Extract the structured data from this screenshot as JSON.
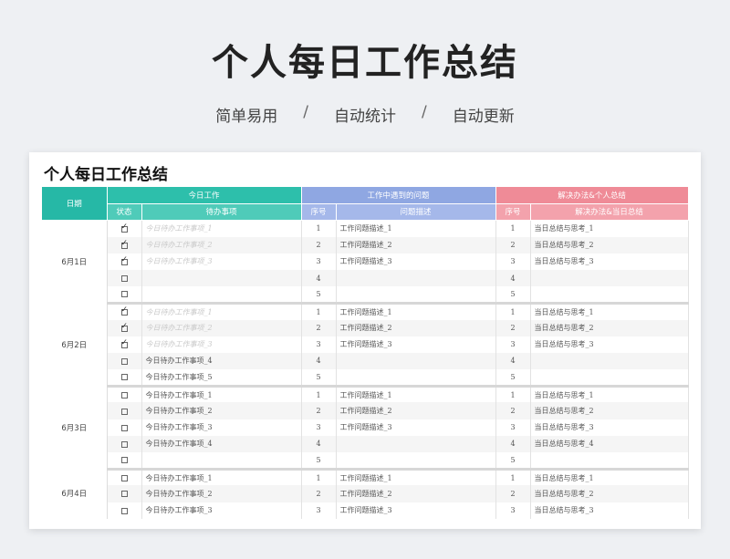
{
  "header": {
    "title": "个人每日工作总结",
    "subtitle_items": [
      "简单易用",
      "自动统计",
      "自动更新"
    ],
    "separator": "/"
  },
  "sheet": {
    "title": "个人每日工作总结",
    "columns": {
      "date": "日期",
      "group_today": "今日工作",
      "group_problems": "工作中遇到的问题",
      "group_solutions": "解决办法&个人总结",
      "status": "状态",
      "todo": "待办事项",
      "seq1": "序号",
      "problem_desc": "问题描述",
      "seq2": "序号",
      "solution_desc": "解决办法&当日总结"
    },
    "days": [
      {
        "date": "6月1日",
        "rows": [
          {
            "checked": true,
            "todo": "今日待办工作事项_1",
            "done": true,
            "seq": "1",
            "problem": "工作问题描述_1",
            "seq2": "1",
            "summary": "当日总结与思考_1"
          },
          {
            "checked": true,
            "todo": "今日待办工作事项_2",
            "done": true,
            "seq": "2",
            "problem": "工作问题描述_2",
            "seq2": "2",
            "summary": "当日总结与思考_2"
          },
          {
            "checked": true,
            "todo": "今日待办工作事项_3",
            "done": true,
            "seq": "3",
            "problem": "工作问题描述_3",
            "seq2": "3",
            "summary": "当日总结与思考_3"
          },
          {
            "checked": false,
            "todo": "",
            "done": false,
            "seq": "4",
            "problem": "",
            "seq2": "4",
            "summary": ""
          },
          {
            "checked": false,
            "todo": "",
            "done": false,
            "seq": "5",
            "problem": "",
            "seq2": "5",
            "summary": ""
          }
        ]
      },
      {
        "date": "6月2日",
        "rows": [
          {
            "checked": true,
            "todo": "今日待办工作事项_1",
            "done": true,
            "seq": "1",
            "problem": "工作问题描述_1",
            "seq2": "1",
            "summary": "当日总结与思考_1"
          },
          {
            "checked": true,
            "todo": "今日待办工作事项_2",
            "done": true,
            "seq": "2",
            "problem": "工作问题描述_2",
            "seq2": "2",
            "summary": "当日总结与思考_2"
          },
          {
            "checked": true,
            "todo": "今日待办工作事项_3",
            "done": true,
            "seq": "3",
            "problem": "工作问题描述_3",
            "seq2": "3",
            "summary": "当日总结与思考_3"
          },
          {
            "checked": false,
            "todo": "今日待办工作事项_4",
            "done": false,
            "seq": "4",
            "problem": "",
            "seq2": "4",
            "summary": ""
          },
          {
            "checked": false,
            "todo": "今日待办工作事项_5",
            "done": false,
            "seq": "5",
            "problem": "",
            "seq2": "5",
            "summary": ""
          }
        ]
      },
      {
        "date": "6月3日",
        "rows": [
          {
            "checked": false,
            "todo": "今日待办工作事项_1",
            "done": false,
            "seq": "1",
            "problem": "工作问题描述_1",
            "seq2": "1",
            "summary": "当日总结与思考_1"
          },
          {
            "checked": false,
            "todo": "今日待办工作事项_2",
            "done": false,
            "seq": "2",
            "problem": "工作问题描述_2",
            "seq2": "2",
            "summary": "当日总结与思考_2"
          },
          {
            "checked": false,
            "todo": "今日待办工作事项_3",
            "done": false,
            "seq": "3",
            "problem": "工作问题描述_3",
            "seq2": "3",
            "summary": "当日总结与思考_3"
          },
          {
            "checked": false,
            "todo": "今日待办工作事项_4",
            "done": false,
            "seq": "4",
            "problem": "",
            "seq2": "4",
            "summary": "当日总结与思考_4"
          },
          {
            "checked": false,
            "todo": "",
            "done": false,
            "seq": "5",
            "problem": "",
            "seq2": "5",
            "summary": ""
          }
        ]
      },
      {
        "date": "6月4日",
        "rows": [
          {
            "checked": false,
            "todo": "今日待办工作事项_1",
            "done": false,
            "seq": "1",
            "problem": "工作问题描述_1",
            "seq2": "1",
            "summary": "当日总结与思考_1"
          },
          {
            "checked": false,
            "todo": "今日待办工作事项_2",
            "done": false,
            "seq": "2",
            "problem": "工作问题描述_2",
            "seq2": "2",
            "summary": "当日总结与思考_2"
          },
          {
            "checked": false,
            "todo": "今日待办工作事项_3",
            "done": false,
            "seq": "3",
            "problem": "工作问题描述_3",
            "seq2": "3",
            "summary": "当日总结与思考_3"
          }
        ]
      }
    ]
  },
  "colors": {
    "today_header": "#2dbfab",
    "problems_header": "#8fa7e2",
    "solutions_header": "#ef8b97"
  }
}
